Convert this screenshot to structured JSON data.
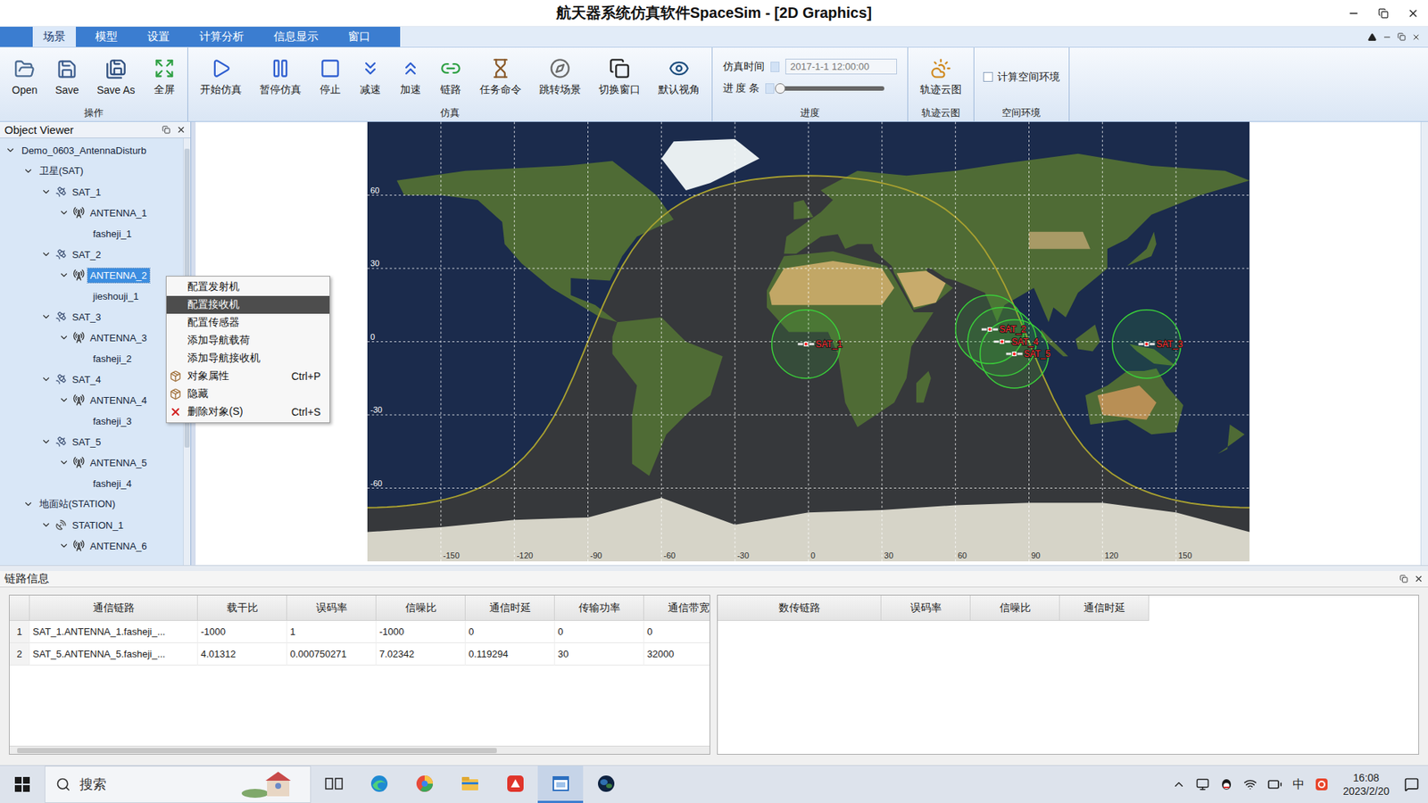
{
  "window": {
    "title": "航天器系统仿真软件SpaceSim - [2D Graphics]"
  },
  "menu_tabs": [
    {
      "label": "场景",
      "selected": true
    },
    {
      "label": "模型",
      "selected": false
    },
    {
      "label": "设置",
      "selected": false
    },
    {
      "label": "计算分析",
      "selected": false
    },
    {
      "label": "信息显示",
      "selected": false
    },
    {
      "label": "窗口",
      "selected": false
    }
  ],
  "ribbon": {
    "groups": [
      {
        "label": "操作",
        "kind": "buttons",
        "buttons": [
          {
            "label": "Open"
          },
          {
            "label": "Save"
          },
          {
            "label": "Save As"
          },
          {
            "label": "全屏"
          }
        ]
      },
      {
        "label": "仿真",
        "kind": "buttons",
        "buttons": [
          {
            "label": "开始仿真"
          },
          {
            "label": "暂停仿真"
          },
          {
            "label": "停止"
          },
          {
            "label": "减速"
          },
          {
            "label": "加速"
          },
          {
            "label": "链路"
          },
          {
            "label": "任务命令"
          },
          {
            "label": "跳转场景"
          },
          {
            "label": "切换窗口"
          },
          {
            "label": "默认视角"
          }
        ]
      },
      {
        "label": "进度",
        "kind": "progress",
        "time_label": "仿真时间",
        "time_value": "2017-1-1 12:00:00",
        "progress_label": "进 度 条",
        "level": 0
      },
      {
        "label": "轨迹云图",
        "kind": "buttons",
        "buttons": [
          {
            "label": "轨迹云图"
          }
        ]
      },
      {
        "label": "空间环境",
        "kind": "checkbox",
        "checkbox": {
          "label": "计算空间环境",
          "checked": false
        }
      }
    ]
  },
  "object_viewer": {
    "title": "Object Viewer",
    "items": [
      {
        "label": "Demo_0603_AntennaDisturb",
        "depth": 0,
        "kind": "root",
        "expanded": true,
        "selected": false
      },
      {
        "label": "卫星(SAT)",
        "depth": 1,
        "kind": "group",
        "expanded": true,
        "selected": false
      },
      {
        "label": "SAT_1",
        "depth": 2,
        "kind": "satellite",
        "expanded": true,
        "selected": false
      },
      {
        "label": "ANTENNA_1",
        "depth": 3,
        "kind": "antenna",
        "expanded": true,
        "selected": false
      },
      {
        "label": "fasheji_1",
        "depth": 4,
        "kind": "payload",
        "selected": false
      },
      {
        "label": "SAT_2",
        "depth": 2,
        "kind": "satellite",
        "expanded": true,
        "selected": false
      },
      {
        "label": "ANTENNA_2",
        "depth": 3,
        "kind": "antenna",
        "expanded": true,
        "selected": true
      },
      {
        "label": "jieshouji_1",
        "depth": 4,
        "kind": "payload",
        "selected": false
      },
      {
        "label": "SAT_3",
        "depth": 2,
        "kind": "satellite",
        "expanded": true,
        "selected": false
      },
      {
        "label": "ANTENNA_3",
        "depth": 3,
        "kind": "antenna",
        "expanded": true,
        "selected": false
      },
      {
        "label": "fasheji_2",
        "depth": 4,
        "kind": "payload",
        "selected": false
      },
      {
        "label": "SAT_4",
        "depth": 2,
        "kind": "satellite",
        "expanded": true,
        "selected": false
      },
      {
        "label": "ANTENNA_4",
        "depth": 3,
        "kind": "antenna",
        "expanded": true,
        "selected": false
      },
      {
        "label": "fasheji_3",
        "depth": 4,
        "kind": "payload",
        "selected": false
      },
      {
        "label": "SAT_5",
        "depth": 2,
        "kind": "satellite",
        "expanded": true,
        "selected": false
      },
      {
        "label": "ANTENNA_5",
        "depth": 3,
        "kind": "antenna",
        "expanded": true,
        "selected": false
      },
      {
        "label": "fasheji_4",
        "depth": 4,
        "kind": "payload",
        "selected": false
      },
      {
        "label": "地面站(STATION)",
        "depth": 1,
        "kind": "group",
        "expanded": true,
        "selected": false
      },
      {
        "label": "STATION_1",
        "depth": 2,
        "kind": "station",
        "expanded": true,
        "selected": false
      },
      {
        "label": "ANTENNA_6",
        "depth": 3,
        "kind": "antenna",
        "expanded": true,
        "selected": false
      }
    ]
  },
  "context_menu": {
    "items": [
      {
        "label": "配置发射机",
        "shortcut": "",
        "kind": "plain",
        "selected": false
      },
      {
        "label": "配置接收机",
        "shortcut": "",
        "kind": "plain",
        "selected": true
      },
      {
        "label": "配置传感器",
        "shortcut": "",
        "kind": "plain",
        "selected": false
      },
      {
        "label": "添加导航载荷",
        "shortcut": "",
        "kind": "plain",
        "selected": false
      },
      {
        "label": "添加导航接收机",
        "shortcut": "",
        "kind": "plain",
        "selected": false
      },
      {
        "label": "对象属性",
        "shortcut": "Ctrl+P",
        "kind": "properties",
        "selected": false
      },
      {
        "label": "隐藏",
        "shortcut": "",
        "kind": "hide",
        "selected": false
      },
      {
        "label": "删除对象(S)",
        "shortcut": "Ctrl+S",
        "kind": "delete",
        "selected": false
      }
    ]
  },
  "map": {
    "lat_labels": [
      "60",
      "30",
      "0",
      "-30",
      "-60"
    ],
    "lon_labels": [
      "-150",
      "-120",
      "-90",
      "-60",
      "-30",
      "0",
      "30",
      "60",
      "90",
      "120",
      "150"
    ],
    "satellites": [
      {
        "label": "SAT_1",
        "lon": -1,
        "lat": -1
      },
      {
        "label": "SAT_2",
        "lon": 74,
        "lat": 5
      },
      {
        "label": "SAT_4",
        "lon": 79,
        "lat": 0
      },
      {
        "label": "SAT_5",
        "lon": 84,
        "lat": -5
      },
      {
        "label": "SAT_3",
        "lon": 138,
        "lat": -1
      }
    ]
  },
  "link_panel": {
    "title": "链路信息",
    "comm_table": {
      "columns": [
        "",
        "通信链路",
        "载干比",
        "误码率",
        "信噪比",
        "通信时延",
        "传输功率",
        "通信带宽"
      ],
      "rows": [
        {
          "index": "1",
          "cells": [
            "SAT_1.ANTENNA_1.fasheji_...",
            "-1000",
            "1",
            "-1000",
            "0",
            "0",
            "0"
          ]
        },
        {
          "index": "2",
          "cells": [
            "SAT_5.ANTENNA_5.fasheji_...",
            "4.01312",
            "0.000750271",
            "7.02342",
            "0.119294",
            "30",
            "32000"
          ]
        }
      ]
    },
    "data_table": {
      "columns": [
        "数传链路",
        "误码率",
        "信噪比",
        "通信时延"
      ],
      "rows": []
    }
  },
  "taskbar": {
    "search": {
      "placeholder": "搜索"
    },
    "apps": [
      {
        "selected": false
      },
      {
        "selected": false
      },
      {
        "selected": false
      },
      {
        "selected": false
      },
      {
        "selected": false
      },
      {
        "selected": true
      },
      {
        "selected": false
      }
    ],
    "ime": "中",
    "time": "16:08",
    "date": "2023/2/20"
  }
}
